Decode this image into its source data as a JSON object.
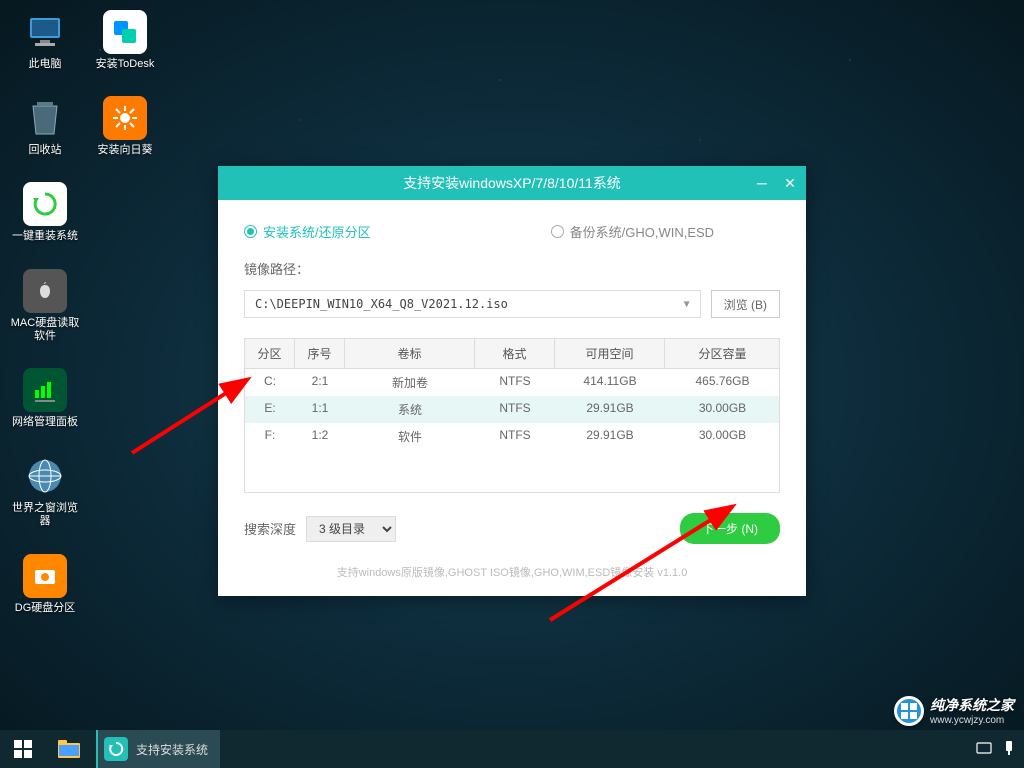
{
  "desktop": {
    "icons": [
      [
        {
          "label": "此电脑",
          "bg": "transparent",
          "glyph": "🖥️"
        },
        {
          "label": "安装ToDesk",
          "bg": "#fff",
          "glyph": "📘"
        }
      ],
      [
        {
          "label": "回收站",
          "bg": "transparent",
          "glyph": "🗑️"
        },
        {
          "label": "安装向日葵",
          "bg": "#ff7a00",
          "glyph": "🌻"
        }
      ],
      [
        {
          "label": "一键重装系统",
          "bg": "#fff",
          "glyph": "🔄"
        }
      ],
      [
        {
          "label": "MAC硬盘读取软件",
          "bg": "#555",
          "glyph": "🍎"
        }
      ],
      [
        {
          "label": "网络管理面板",
          "bg": "#0a4",
          "glyph": "📊"
        }
      ],
      [
        {
          "label": "世界之窗浏览器",
          "bg": "transparent",
          "glyph": "🌐"
        }
      ],
      [
        {
          "label": "DG硬盘分区",
          "bg": "#f80",
          "glyph": "💾"
        }
      ]
    ]
  },
  "dialog": {
    "title": "支持安装windowsXP/7/8/10/11系统",
    "radio1": "安装系统/还原分区",
    "radio2": "备份系统/GHO,WIN,ESD",
    "path_label": "镜像路径：",
    "path_value": "C:\\DEEPIN_WIN10_X64_Q8_V2021.12.iso",
    "browse": "浏览 (B)",
    "headers": [
      "分区",
      "序号",
      "卷标",
      "格式",
      "可用空间",
      "分区容量"
    ],
    "rows": [
      {
        "partition": "C:",
        "num": "2:1",
        "label": "新加卷",
        "fmt": "NTFS",
        "free": "414.11GB",
        "size": "465.76GB",
        "selected": false
      },
      {
        "partition": "E:",
        "num": "1:1",
        "label": "系统",
        "fmt": "NTFS",
        "free": "29.91GB",
        "size": "30.00GB",
        "selected": true
      },
      {
        "partition": "F:",
        "num": "1:2",
        "label": "软件",
        "fmt": "NTFS",
        "free": "29.91GB",
        "size": "30.00GB",
        "selected": false
      }
    ],
    "search_label": "搜索深度",
    "search_value": "3 级目录",
    "next": "下一步 (N)",
    "footer": "支持windows原版镜像,GHOST ISO镜像,GHO,WIM,ESD镜像安装 v1.1.0"
  },
  "taskbar": {
    "active": "支持安装系统"
  },
  "watermark": {
    "brand": "纯净系统之家",
    "url": "www.ycwjzy.com"
  }
}
